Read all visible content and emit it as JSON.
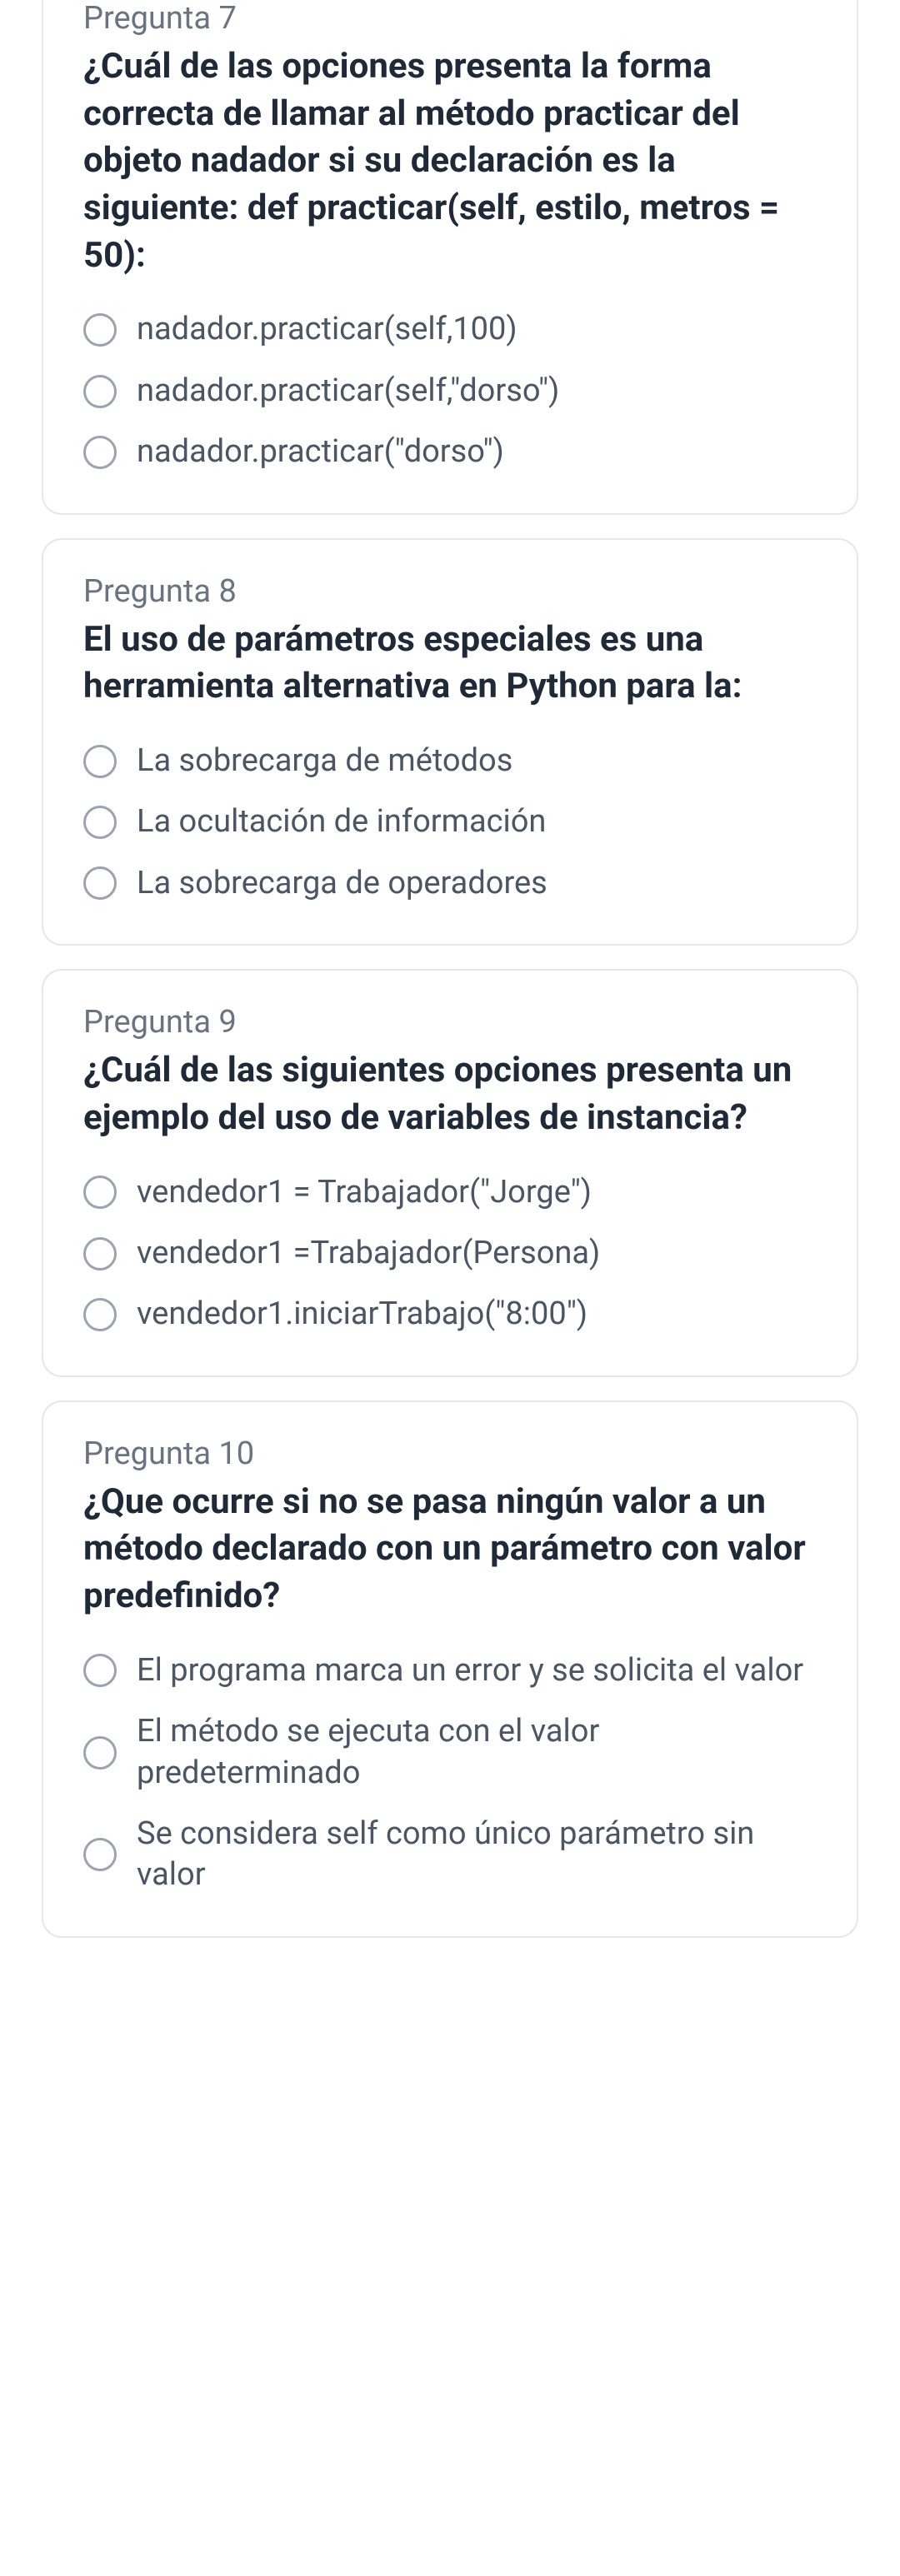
{
  "questions": [
    {
      "number": "Pregunta 7",
      "title": "¿Cuál de las opciones presenta la forma correcta de llamar al método practicar del objeto nadador si su declaración es la siguiente: def practicar(self, estilo, metros = 50):",
      "options": [
        "nadador.practicar(self,100)",
        "nadador.practicar(self,\"dorso\")",
        "nadador.practicar(\"dorso\")"
      ]
    },
    {
      "number": "Pregunta 8",
      "title": "El uso de parámetros especiales es una herramienta alternativa en Python para la:",
      "options": [
        "La sobrecarga de métodos",
        "La ocultación de información",
        "La sobrecarga de operadores"
      ]
    },
    {
      "number": "Pregunta 9",
      "title": "¿Cuál de las siguientes opciones presenta un ejemplo del uso de variables de instancia?",
      "options": [
        "vendedor1 = Trabajador(\"Jorge\")",
        "vendedor1 =Trabajador(Persona)",
        "vendedor1.iniciarTrabajo(\"8:00\")"
      ]
    },
    {
      "number": "Pregunta 10",
      "title": "¿Que ocurre si no se pasa ningún valor a un método declarado con un parámetro con valor predefinido?",
      "options": [
        "El programa marca un error y se solicita el valor",
        "El método se ejecuta con el valor predeterminado",
        "Se considera self como único parámetro sin valor"
      ]
    }
  ]
}
